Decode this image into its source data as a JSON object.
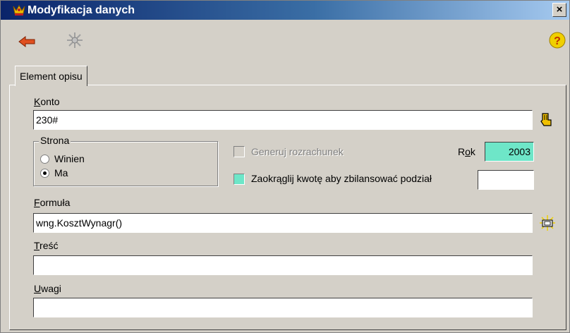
{
  "window": {
    "title": "Modyfikacja danych",
    "close_glyph": "×"
  },
  "toolbar": {
    "back_icon": "back-arrow-icon",
    "disabled_icon": "spark-icon",
    "help_icon": "help-icon",
    "help_glyph": "?"
  },
  "tabs": [
    {
      "label": "Element opisu"
    }
  ],
  "form": {
    "konto": {
      "label_u": "K",
      "label_rest": "onto",
      "value": "230#"
    },
    "strona": {
      "title": "Strona",
      "options": [
        {
          "label": "Winien",
          "checked": false
        },
        {
          "label": "Ma",
          "checked": true
        }
      ]
    },
    "generuj_rozrachunek": {
      "label": "Generuj rozrachunek",
      "enabled": false,
      "checked": false
    },
    "rok": {
      "label_pre": "R",
      "label_u": "o",
      "label_rest": "k",
      "value": "2003",
      "color": "#6ee6c8"
    },
    "zaokraglij": {
      "label": "Zaokrąglij kwotę aby zbilansować podział",
      "checked": false,
      "value": ""
    },
    "formula": {
      "label_u": "F",
      "label_rest": "ormuła",
      "value": "wng.KosztWynagr()"
    },
    "tresc": {
      "label_u": "T",
      "label_rest": "reść",
      "value": ""
    },
    "uwagi": {
      "label_u": "U",
      "label_rest": "wagi",
      "value": ""
    }
  }
}
